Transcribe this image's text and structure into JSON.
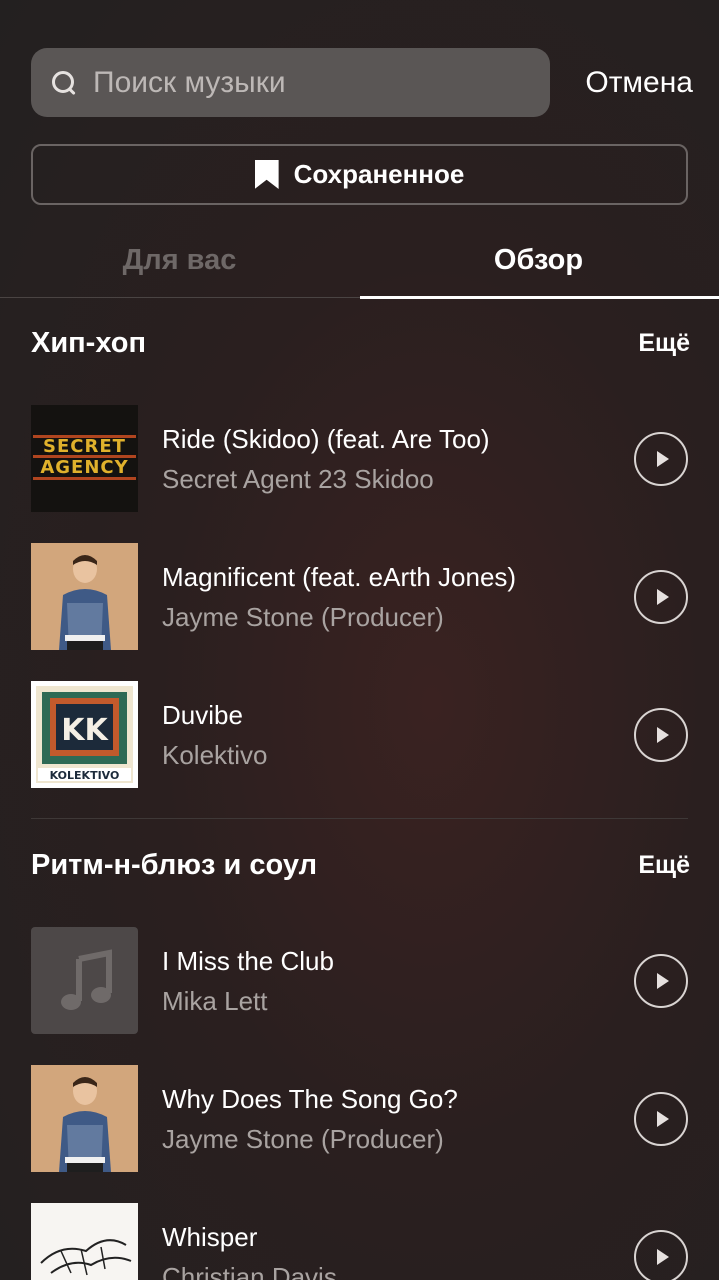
{
  "search": {
    "placeholder": "Поиск музыки",
    "value": "",
    "cancel_label": "Отмена"
  },
  "saved": {
    "label": "Сохраненное"
  },
  "tabs": [
    {
      "label": "Для вас",
      "active": false
    },
    {
      "label": "Обзор",
      "active": true
    }
  ],
  "sections": [
    {
      "title": "Хип-хоп",
      "more_label": "Ещё",
      "tracks": [
        {
          "title": "Ride (Skidoo) (feat. Are Too)",
          "artist": "Secret Agent 23 Skidoo",
          "cover_text": [
            "SECRET",
            "AGENCY"
          ]
        },
        {
          "title": "Magnificent (feat. eArth Jones)",
          "artist": "Jayme Stone (Producer)"
        },
        {
          "title": "Duvibe",
          "artist": "Kolektivo",
          "cover_text": [
            "KK",
            "KOLEKTIVO"
          ]
        }
      ]
    },
    {
      "title": "Ритм-н-блюз и соул",
      "more_label": "Ещё",
      "tracks": [
        {
          "title": "I Miss the Club",
          "artist": "Mika Lett"
        },
        {
          "title": "Why Does The Song Go?",
          "artist": "Jayme Stone (Producer)"
        },
        {
          "title": "Whisper",
          "artist": "Christian Davis"
        }
      ]
    }
  ],
  "colors": {
    "background": "#2a1f1f",
    "search_bg": "#5a5655",
    "secondary_text": "#a9a3a1",
    "inactive_tab": "#6e6867"
  },
  "icons": {
    "search": "search-icon",
    "saved": "bookmark-icon",
    "play": "play-icon",
    "music_note": "music-note-icon"
  }
}
